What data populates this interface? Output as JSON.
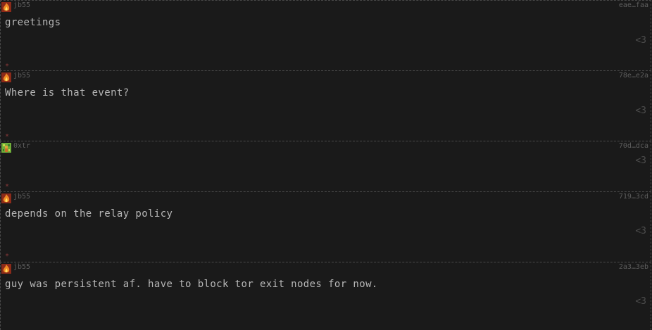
{
  "feed": {
    "posts": [
      {
        "author": "jb55",
        "avatar_icon": "fire-avatar-icon",
        "event_id": "eae…faa",
        "content": "greetings",
        "like_label": "<3",
        "marker": "*"
      },
      {
        "author": "jb55",
        "avatar_icon": "fire-avatar-icon",
        "event_id": "78e…e2a",
        "content": "Where is that event?",
        "like_label": "<3",
        "marker": "*"
      },
      {
        "author": "0xtr",
        "avatar_icon": "pixel-avatar-icon",
        "event_id": "70d…dca",
        "content": "",
        "like_label": "<3",
        "marker": "*"
      },
      {
        "author": "jb55",
        "avatar_icon": "fire-avatar-icon",
        "event_id": "719…3cd",
        "content": "depends on the relay policy",
        "like_label": "<3",
        "marker": "*"
      },
      {
        "author": "jb55",
        "avatar_icon": "fire-avatar-icon",
        "event_id": "2a3…3eb",
        "content": "guy was persistent af. have to block tor exit nodes for now.",
        "like_label": "<3"
      }
    ]
  },
  "colors": {
    "background": "#1a1a1a",
    "text": "#b6b6b6",
    "meta": "#5e5e5e",
    "marker": "#8a3a3a"
  }
}
